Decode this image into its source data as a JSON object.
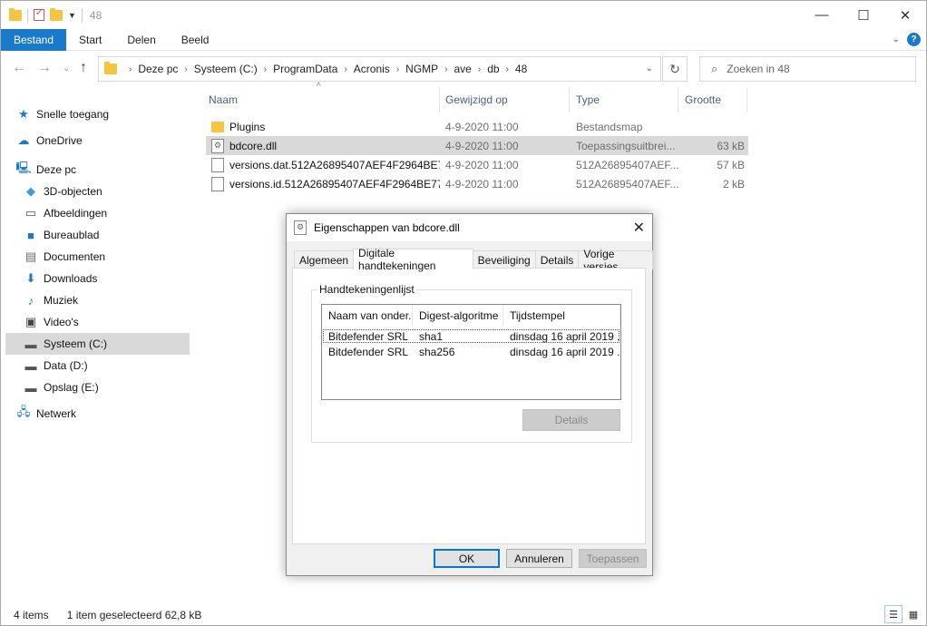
{
  "window": {
    "title": "48"
  },
  "ribbon": {
    "tabs": [
      "Bestand",
      "Start",
      "Delen",
      "Beeld"
    ]
  },
  "address": {
    "crumbs": [
      "Deze pc",
      "Systeem (C:)",
      "ProgramData",
      "Acronis",
      "NGMP",
      "ave",
      "db",
      "48"
    ]
  },
  "search": {
    "placeholder": "Zoeken in 48"
  },
  "sidebar": {
    "items": [
      {
        "label": "Snelle toegang",
        "icon": "star-icon"
      },
      {
        "label": "OneDrive",
        "icon": "cloud-icon"
      },
      {
        "label": "Deze pc",
        "icon": "computer-icon"
      },
      {
        "label": "3D-objecten",
        "icon": "cube-icon"
      },
      {
        "label": "Afbeeldingen",
        "icon": "pictures-icon"
      },
      {
        "label": "Bureaublad",
        "icon": "desktop-icon"
      },
      {
        "label": "Documenten",
        "icon": "documents-icon"
      },
      {
        "label": "Downloads",
        "icon": "download-icon"
      },
      {
        "label": "Muziek",
        "icon": "music-icon"
      },
      {
        "label": "Video's",
        "icon": "video-icon"
      },
      {
        "label": "Systeem (C:)",
        "icon": "drive-icon"
      },
      {
        "label": "Data (D:)",
        "icon": "drive-icon"
      },
      {
        "label": "Opslag (E:)",
        "icon": "drive-icon"
      },
      {
        "label": "Netwerk",
        "icon": "network-icon"
      }
    ]
  },
  "columns": {
    "name": "Naam",
    "date": "Gewijzigd op",
    "type": "Type",
    "size": "Grootte"
  },
  "files": [
    {
      "name": "Plugins",
      "date": "4-9-2020 11:00",
      "type": "Bestandsmap",
      "size": "",
      "icon": "folder-icon"
    },
    {
      "name": "bdcore.dll",
      "date": "4-9-2020 11:00",
      "type": "Toepassingsuitbrei...",
      "size": "63 kB",
      "icon": "dll-file-icon"
    },
    {
      "name": "versions.dat.512A26895407AEF4F2964BE7...",
      "date": "4-9-2020 11:00",
      "type": "512A26895407AEF...",
      "size": "57 kB",
      "icon": "file-icon"
    },
    {
      "name": "versions.id.512A26895407AEF4F2964BE77...",
      "date": "4-9-2020 11:00",
      "type": "512A26895407AEF...",
      "size": "2 kB",
      "icon": "file-icon"
    }
  ],
  "status": {
    "count": "4 items",
    "selection": "1 item geselecteerd  62,8 kB"
  },
  "dialog": {
    "title": "Eigenschappen van bdcore.dll",
    "tabs": [
      "Algemeen",
      "Digitale handtekeningen",
      "Beveiliging",
      "Details",
      "Vorige versies"
    ],
    "group_label": "Handtekeningenlijst",
    "sig_columns": [
      "Naam van onder...",
      "Digest-algoritme",
      "Tijdstempel"
    ],
    "signatures": [
      {
        "name": "Bitdefender SRL",
        "digest": "sha1",
        "timestamp": "dinsdag 16 april 2019 ..."
      },
      {
        "name": "Bitdefender SRL",
        "digest": "sha256",
        "timestamp": "dinsdag 16 april 2019 ..."
      }
    ],
    "details_button": "Details",
    "ok_button": "OK",
    "cancel_button": "Annuleren",
    "apply_button": "Toepassen"
  },
  "colors": {
    "accent": "#1979ca",
    "selection": "#d9d9d9",
    "folder": "#f5c542"
  }
}
